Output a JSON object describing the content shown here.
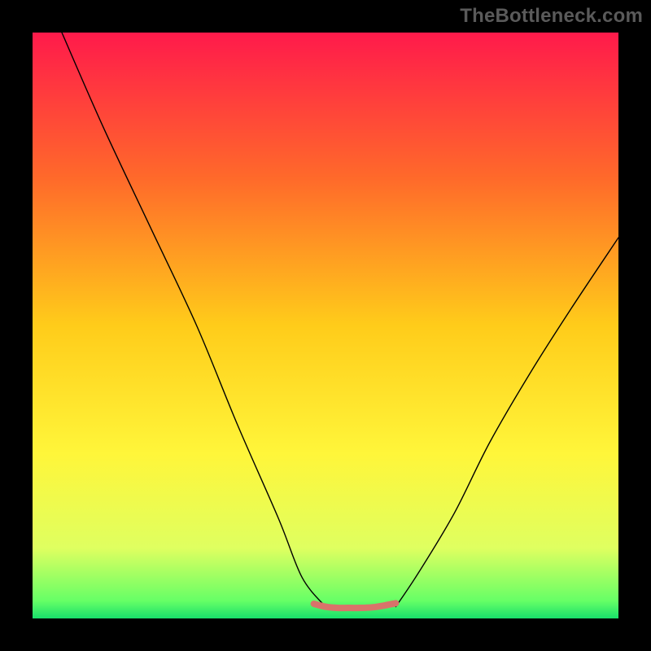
{
  "watermark": "TheBottleneck.com",
  "chart_data": {
    "type": "line",
    "title": "",
    "xlabel": "",
    "ylabel": "",
    "xlim": [
      0,
      100
    ],
    "ylim": [
      0,
      100
    ],
    "grid": false,
    "legend": false,
    "gradient_stops": [
      {
        "t": 0.0,
        "color": "#ff1a4b"
      },
      {
        "t": 0.25,
        "color": "#ff6a2a"
      },
      {
        "t": 0.5,
        "color": "#ffcc1a"
      },
      {
        "t": 0.72,
        "color": "#fff63a"
      },
      {
        "t": 0.88,
        "color": "#dfff60"
      },
      {
        "t": 0.97,
        "color": "#66ff66"
      },
      {
        "t": 1.0,
        "color": "#18e06b"
      }
    ],
    "series": [
      {
        "name": "left-descent",
        "x": [
          5,
          12,
          20,
          28,
          35,
          42,
          46,
          50
        ],
        "values": [
          100,
          84,
          67,
          50,
          33,
          17,
          7,
          2
        ],
        "stroke": "#000000",
        "width": 1.4
      },
      {
        "name": "right-ascent",
        "x": [
          62,
          66,
          72,
          78,
          85,
          92,
          100
        ],
        "values": [
          2,
          8,
          18,
          30,
          42,
          53,
          65
        ],
        "stroke": "#000000",
        "width": 1.4
      },
      {
        "name": "trough-band",
        "x": [
          48,
          50,
          52,
          54,
          56,
          58,
          60,
          62
        ],
        "values": [
          2.5,
          2.0,
          1.8,
          1.8,
          1.8,
          1.9,
          2.2,
          2.6
        ],
        "stroke": "#d9736a",
        "width": 8
      }
    ]
  }
}
